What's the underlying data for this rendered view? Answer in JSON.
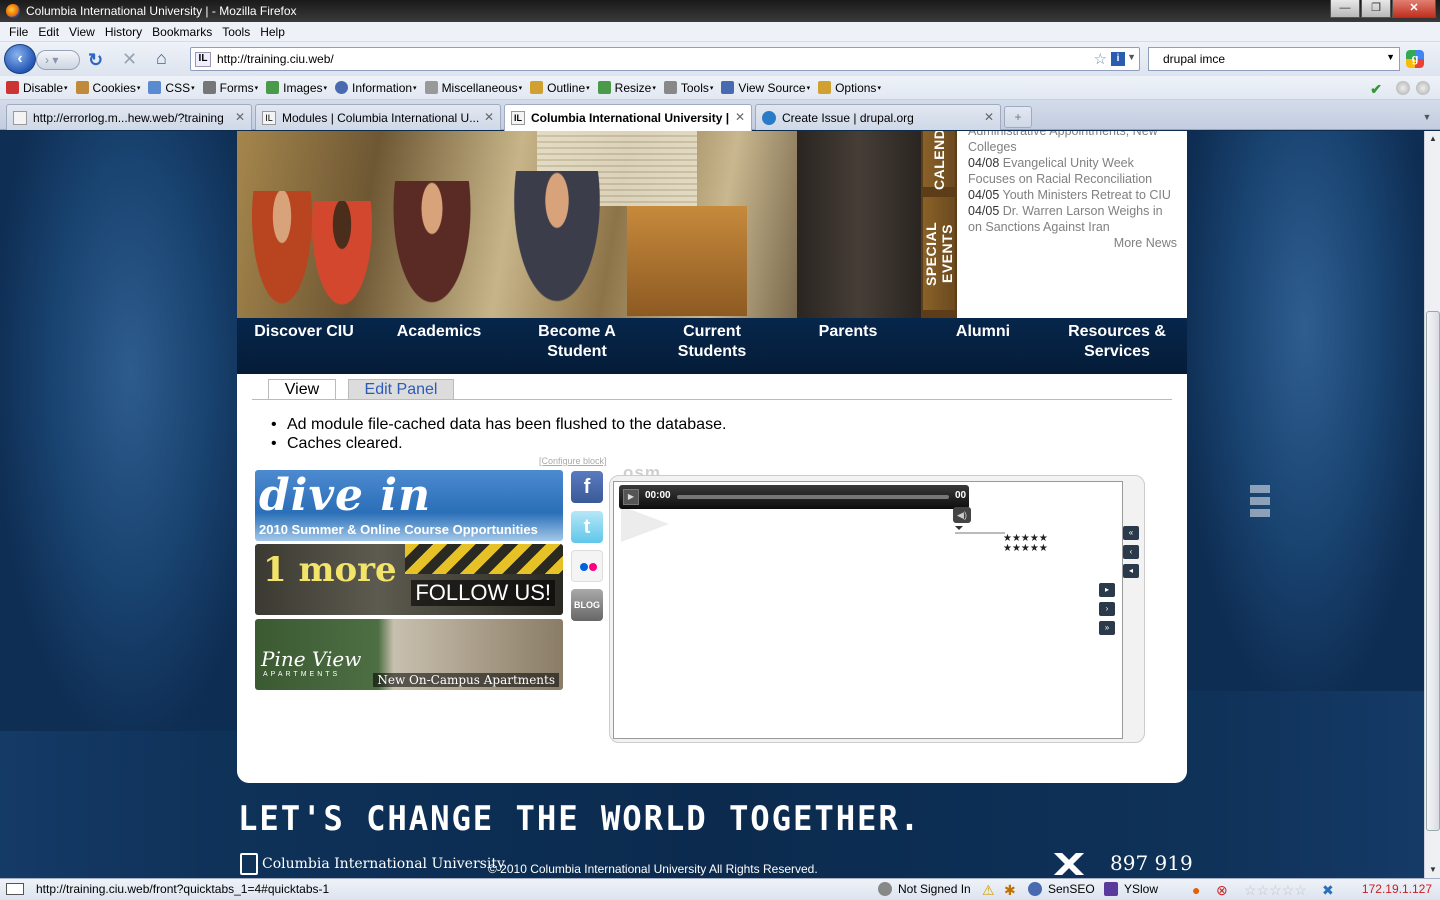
{
  "window": {
    "title": "Columbia International University | - Mozilla Firefox",
    "buttons": [
      "—",
      "❐",
      "✕"
    ]
  },
  "menu": [
    "File",
    "Edit",
    "View",
    "History",
    "Bookmarks",
    "Tools",
    "Help"
  ],
  "navbar": {
    "url": "http://training.ciu.web/",
    "search_value": "drupal imce"
  },
  "devtoolbar": [
    {
      "label": "Disable",
      "icon": "disable-icon",
      "color": "#cc3333"
    },
    {
      "label": "Cookies",
      "icon": "cookie-icon",
      "color": "#c08a3a"
    },
    {
      "label": "CSS",
      "icon": "css-icon",
      "color": "#5a8ad0"
    },
    {
      "label": "Forms",
      "icon": "forms-icon",
      "color": "#777777"
    },
    {
      "label": "Images",
      "icon": "images-icon",
      "color": "#4a9a4a"
    },
    {
      "label": "Information",
      "icon": "info-icon",
      "color": "#4a6ab0"
    },
    {
      "label": "Miscellaneous",
      "icon": "misc-icon",
      "color": "#999999"
    },
    {
      "label": "Outline",
      "icon": "outline-icon",
      "color": "#d0a030"
    },
    {
      "label": "Resize",
      "icon": "resize-icon",
      "color": "#4a9a4a"
    },
    {
      "label": "Tools",
      "icon": "tools-icon",
      "color": "#888888"
    },
    {
      "label": "View Source",
      "icon": "view-source-icon",
      "color": "#4a6ab0"
    },
    {
      "label": "Options",
      "icon": "options-icon",
      "color": "#d0a030"
    }
  ],
  "tabs": [
    {
      "title": "http://errorlog.m...hew.web/?training"
    },
    {
      "title": "Modules | Columbia International U..."
    },
    {
      "title": "Columbia International University |",
      "active": true
    },
    {
      "title": "Create Issue | drupal.org"
    }
  ],
  "page": {
    "side_tabs": {
      "calendar": "CALEND",
      "special": "SPECIAL EVENTS"
    },
    "news": {
      "partial_top": "Administrative Appointments, New Colleges",
      "items": [
        {
          "date": "04/08",
          "text": "Evangelical Unity Week Focuses on Racial Reconciliation"
        },
        {
          "date": "04/05",
          "text": "Youth Ministers Retreat to CIU"
        },
        {
          "date": "04/05",
          "text": "Dr. Warren Larson Weighs in on Sanctions Against Iran"
        }
      ],
      "more": "More News"
    },
    "main_nav": [
      {
        "line1": "Discover CIU",
        "line2": ""
      },
      {
        "line1": "Academics",
        "line2": ""
      },
      {
        "line1": "Become A",
        "line2": "Student"
      },
      {
        "line1": "Current Students",
        "line2": ""
      },
      {
        "line1": "Parents",
        "line2": ""
      },
      {
        "line1": "Alumni",
        "line2": ""
      },
      {
        "line1": "Resources &",
        "line2": "Services"
      }
    ],
    "content_tabs": {
      "view": "View",
      "edit": "Edit Panel"
    },
    "messages": [
      "Ad module file-cached data has been flushed to the database.",
      "Caches cleared."
    ],
    "configure_block": "[Configure block]",
    "banners": {
      "dive_big": "dive in",
      "dive_small": "2010 Summer & Online Course Opportunities",
      "follow_logo": "1 more",
      "follow_label": "FOLLOW US!",
      "pine_logo": "Pine View",
      "pine_sub": "APARTMENTS",
      "pine_caption": "New On-Campus Apartments"
    },
    "social": {
      "facebook": "f",
      "twitter": "t",
      "flickr": "",
      "blog": "BLOG"
    },
    "player": {
      "label": "osm",
      "time_start": "00:00",
      "time_end": "00",
      "stars": "★★★★★\n★★★★★"
    },
    "footer": {
      "slogan": "LET'S CHANGE THE WORLD TOGETHER.",
      "logo": "Columbia International University",
      "copyright": "© 2010 Columbia International University All Rights Reserved.",
      "phone": "897 919"
    }
  },
  "statusbar": {
    "url": "http://training.ciu.web/front?quicktabs_1=4#quicktabs-1",
    "not_signed_in": "Not Signed In",
    "senseo": "SenSEO",
    "yslow": "YSlow",
    "rating": "☆☆☆☆☆",
    "ip": "172.19.1.127"
  }
}
